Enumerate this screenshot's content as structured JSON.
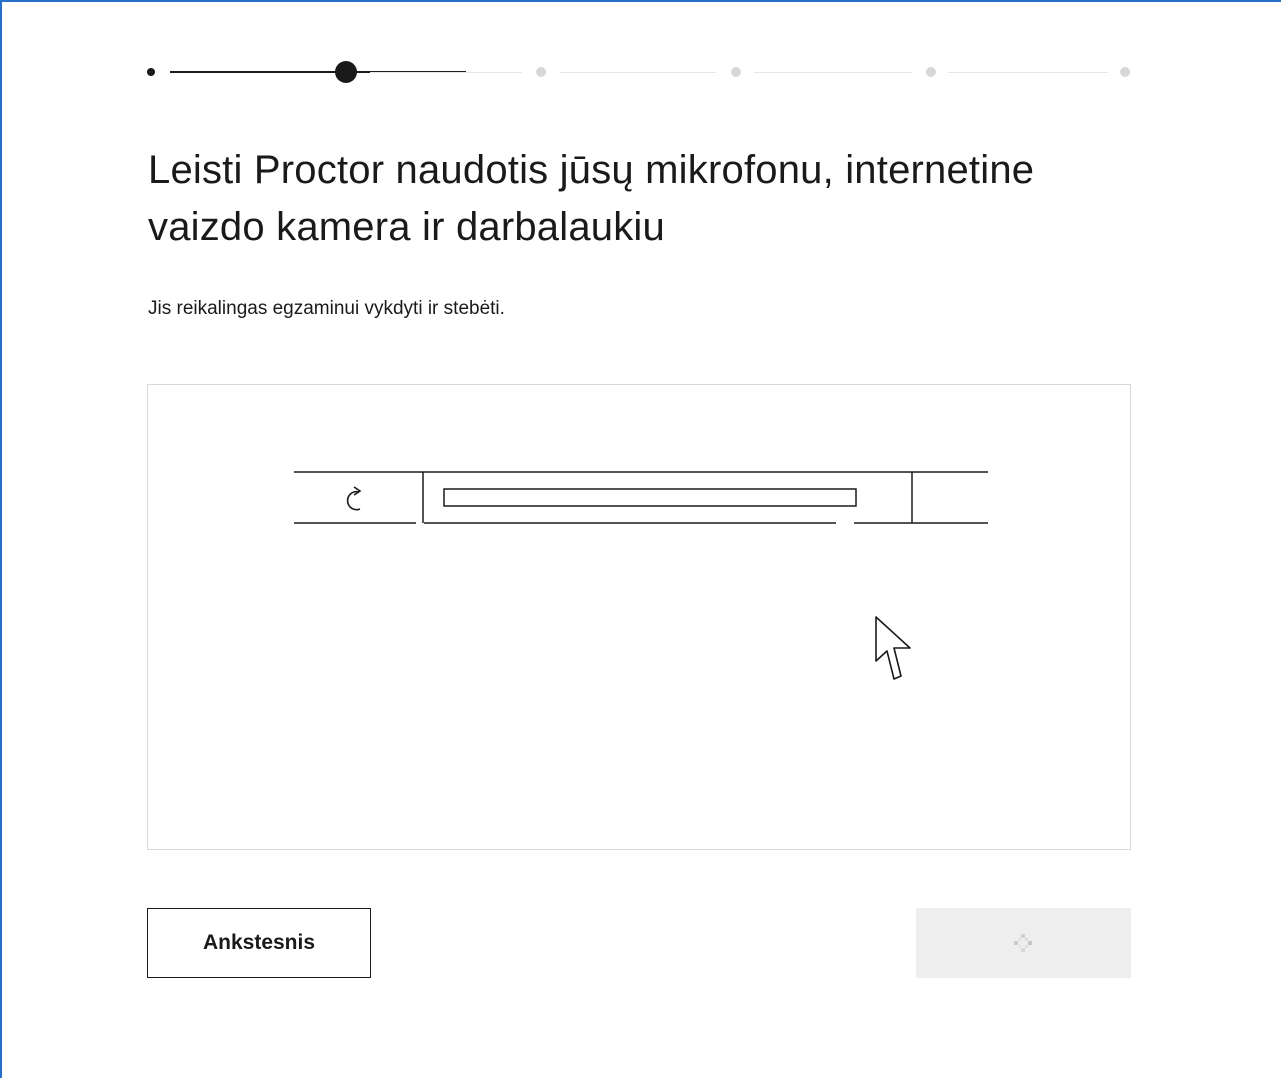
{
  "stepper": {
    "total_steps": 6,
    "current_step": 2
  },
  "header": {
    "title": "Leisti Proctor naudotis jūsų mikrofonu, internetine vaizdo kamera ir darbalaukiu"
  },
  "description": "Jis reikalingas egzaminui vykdyti ir stebėti.",
  "illustration": {
    "refresh_icon": "refresh-icon",
    "cursor_icon": "mouse-pointer-icon"
  },
  "buttons": {
    "previous_label": "Ankstesnis",
    "next_state": "loading",
    "next_icon": "loading-spinner-icon"
  },
  "colors": {
    "accent_border": "#2a6fc9",
    "text": "#1a1a1a",
    "inactive_step": "#d7d7d7",
    "disabled_button": "#eeeeee"
  }
}
